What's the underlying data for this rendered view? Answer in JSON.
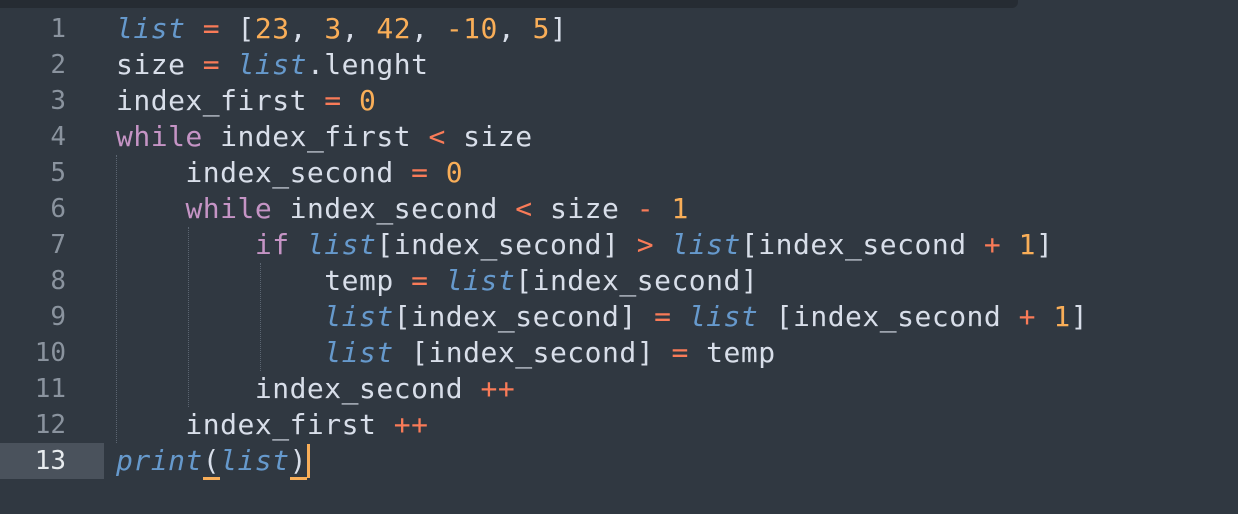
{
  "editor": {
    "line_numbers": [
      "1",
      "2",
      "3",
      "4",
      "5",
      "6",
      "7",
      "8",
      "9",
      "10",
      "11",
      "12",
      "13"
    ],
    "active_line": "13",
    "lines": [
      [
        {
          "t": "list",
          "c": "list"
        },
        {
          "t": " ",
          "c": "var"
        },
        {
          "t": "=",
          "c": "op"
        },
        {
          "t": " ",
          "c": "var"
        },
        {
          "t": "[",
          "c": "punc"
        },
        {
          "t": "23",
          "c": "num"
        },
        {
          "t": ", ",
          "c": "punc"
        },
        {
          "t": "3",
          "c": "num"
        },
        {
          "t": ", ",
          "c": "punc"
        },
        {
          "t": "42",
          "c": "num"
        },
        {
          "t": ", ",
          "c": "punc"
        },
        {
          "t": "-10",
          "c": "num"
        },
        {
          "t": ", ",
          "c": "punc"
        },
        {
          "t": "5",
          "c": "num"
        },
        {
          "t": "]",
          "c": "punc"
        }
      ],
      [
        {
          "t": "size ",
          "c": "var"
        },
        {
          "t": "=",
          "c": "op"
        },
        {
          "t": " ",
          "c": "var"
        },
        {
          "t": "list",
          "c": "list"
        },
        {
          "t": ".lenght",
          "c": "var"
        }
      ],
      [
        {
          "t": "index_first ",
          "c": "var"
        },
        {
          "t": "=",
          "c": "op"
        },
        {
          "t": " ",
          "c": "var"
        },
        {
          "t": "0",
          "c": "num"
        }
      ],
      [
        {
          "t": "while",
          "c": "kw"
        },
        {
          "t": " index_first ",
          "c": "var"
        },
        {
          "t": "<",
          "c": "op"
        },
        {
          "t": " size",
          "c": "var"
        }
      ],
      [
        {
          "t": "    index_second ",
          "c": "var"
        },
        {
          "t": "=",
          "c": "op"
        },
        {
          "t": " ",
          "c": "var"
        },
        {
          "t": "0",
          "c": "num"
        }
      ],
      [
        {
          "t": "    ",
          "c": "var"
        },
        {
          "t": "while",
          "c": "kw"
        },
        {
          "t": " index_second ",
          "c": "var"
        },
        {
          "t": "<",
          "c": "op"
        },
        {
          "t": " size ",
          "c": "var"
        },
        {
          "t": "-",
          "c": "op"
        },
        {
          "t": " ",
          "c": "var"
        },
        {
          "t": "1",
          "c": "num"
        }
      ],
      [
        {
          "t": "        ",
          "c": "var"
        },
        {
          "t": "if",
          "c": "kw"
        },
        {
          "t": " ",
          "c": "var"
        },
        {
          "t": "list",
          "c": "list"
        },
        {
          "t": "[index_second] ",
          "c": "var"
        },
        {
          "t": ">",
          "c": "op"
        },
        {
          "t": " ",
          "c": "var"
        },
        {
          "t": "list",
          "c": "list"
        },
        {
          "t": "[index_second ",
          "c": "var"
        },
        {
          "t": "+",
          "c": "op"
        },
        {
          "t": " ",
          "c": "var"
        },
        {
          "t": "1",
          "c": "num"
        },
        {
          "t": "]",
          "c": "punc"
        }
      ],
      [
        {
          "t": "            temp ",
          "c": "var"
        },
        {
          "t": "=",
          "c": "op"
        },
        {
          "t": " ",
          "c": "var"
        },
        {
          "t": "list",
          "c": "list"
        },
        {
          "t": "[index_second]",
          "c": "var"
        }
      ],
      [
        {
          "t": "            ",
          "c": "var"
        },
        {
          "t": "list",
          "c": "list"
        },
        {
          "t": "[index_second] ",
          "c": "var"
        },
        {
          "t": "=",
          "c": "op"
        },
        {
          "t": " ",
          "c": "var"
        },
        {
          "t": "list",
          "c": "list"
        },
        {
          "t": " [index_second ",
          "c": "var"
        },
        {
          "t": "+",
          "c": "op"
        },
        {
          "t": " ",
          "c": "var"
        },
        {
          "t": "1",
          "c": "num"
        },
        {
          "t": "]",
          "c": "punc"
        }
      ],
      [
        {
          "t": "            ",
          "c": "var"
        },
        {
          "t": "list",
          "c": "list"
        },
        {
          "t": " [index_second] ",
          "c": "var"
        },
        {
          "t": "=",
          "c": "op"
        },
        {
          "t": " temp",
          "c": "var"
        }
      ],
      [
        {
          "t": "        index_second ",
          "c": "var"
        },
        {
          "t": "++",
          "c": "op"
        }
      ],
      [
        {
          "t": "    index_first ",
          "c": "var"
        },
        {
          "t": "++",
          "c": "op"
        }
      ],
      [
        {
          "t": "print",
          "c": "fn"
        },
        {
          "t": "(",
          "c": "paren"
        },
        {
          "t": "list",
          "c": "list"
        },
        {
          "t": ")",
          "c": "paren"
        }
      ]
    ]
  },
  "colors": {
    "background": "#303841",
    "keyword": "#c594c5",
    "operator": "#f97b58",
    "number": "#f9ae58",
    "builtin": "#6699cc",
    "text": "#d8dee9",
    "caret": "#f9ae58"
  }
}
